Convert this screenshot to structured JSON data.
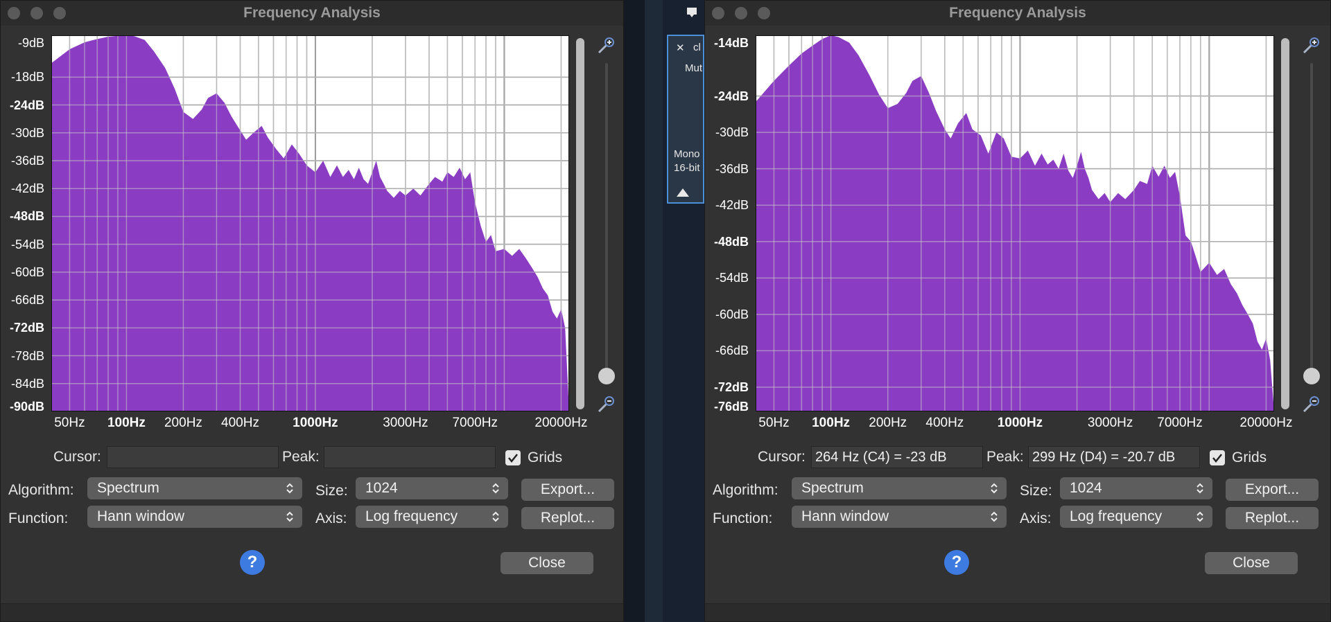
{
  "background_panel": {
    "close_glyph": "✕",
    "track_name": "cl",
    "mute_label": "Mut",
    "format_line1": "Mono",
    "format_line2": "16-bit"
  },
  "left_window": {
    "title": "Frequency Analysis",
    "cursor_label": "Cursor:",
    "cursor_value": "",
    "peak_label": "Peak:",
    "peak_value": "",
    "grids_label": "Grids",
    "grids_checked": true,
    "algorithm_label": "Algorithm:",
    "algorithm_value": "Spectrum",
    "size_label": "Size:",
    "size_value": "1024",
    "function_label": "Function:",
    "function_value": "Hann window",
    "axis_label": "Axis:",
    "axis_value": "Log frequency",
    "export_label": "Export...",
    "replot_label": "Replot...",
    "close_label": "Close",
    "help_glyph": "?",
    "db_labels": [
      "-9dB",
      "-18dB",
      "-24dB",
      "-30dB",
      "-36dB",
      "-42dB",
      "-48dB",
      "-54dB",
      "-60dB",
      "-66dB",
      "-72dB",
      "-78dB",
      "-84dB",
      "-90dB"
    ],
    "hz_labels": [
      "50Hz",
      "100Hz",
      "200Hz",
      "400Hz",
      "1000Hz",
      "3000Hz",
      "7000Hz",
      "20000Hz"
    ]
  },
  "right_window": {
    "title": "Frequency Analysis",
    "cursor_label": "Cursor:",
    "cursor_value": "264 Hz (C4) = -23 dB",
    "peak_label": "Peak:",
    "peak_value": "299 Hz (D4) = -20.7 dB",
    "grids_label": "Grids",
    "grids_checked": true,
    "algorithm_label": "Algorithm:",
    "algorithm_value": "Spectrum",
    "size_label": "Size:",
    "size_value": "1024",
    "function_label": "Function:",
    "function_value": "Hann window",
    "axis_label": "Axis:",
    "axis_value": "Log frequency",
    "export_label": "Export...",
    "replot_label": "Replot...",
    "close_label": "Close",
    "help_glyph": "?",
    "db_labels": [
      "-14dB",
      "-24dB",
      "-30dB",
      "-36dB",
      "-42dB",
      "-48dB",
      "-54dB",
      "-60dB",
      "-66dB",
      "-72dB",
      "-76dB"
    ],
    "hz_labels": [
      "50Hz",
      "100Hz",
      "200Hz",
      "400Hz",
      "1000Hz",
      "3000Hz",
      "7000Hz",
      "20000Hz"
    ]
  },
  "chart_data": [
    {
      "type": "area",
      "xscale": "log",
      "xlim": [
        40,
        22050
      ],
      "ylim": [
        -90,
        -9
      ],
      "ytick_labels": [
        "-9dB",
        "-18dB",
        "-24dB",
        "-30dB",
        "-36dB",
        "-42dB",
        "-48dB",
        "-54dB",
        "-60dB",
        "-66dB",
        "-72dB",
        "-78dB",
        "-84dB",
        "-90dB"
      ],
      "xtick_labels": [
        "50Hz",
        "100Hz",
        "200Hz",
        "400Hz",
        "1000Hz",
        "3000Hz",
        "7000Hz",
        "20000Hz"
      ],
      "grid": true,
      "color": "#8a3cc2",
      "x": [
        40,
        50,
        60,
        70,
        80,
        90,
        100,
        110,
        125,
        140,
        160,
        180,
        200,
        225,
        250,
        270,
        300,
        330,
        360,
        400,
        430,
        470,
        520,
        560,
        620,
        680,
        750,
        820,
        900,
        1000,
        1100,
        1200,
        1300,
        1400,
        1500,
        1600,
        1700,
        1800,
        1900,
        2000,
        2100,
        2200,
        2300,
        2400,
        2600,
        2800,
        3000,
        3300,
        3600,
        4000,
        4300,
        4700,
        5000,
        5400,
        5800,
        6200,
        6600,
        7000,
        7500,
        8000,
        8500,
        9000,
        10000,
        11000,
        12000,
        13000,
        14000,
        15000,
        16000,
        17000,
        18000,
        19000,
        20000,
        21000,
        22050
      ],
      "y": [
        -15,
        -12,
        -10.5,
        -9.8,
        -9.3,
        -9.1,
        -9,
        -9.2,
        -10,
        -12.5,
        -16,
        -20.5,
        -25.5,
        -27,
        -25,
        -22.5,
        -21.5,
        -23.5,
        -26.5,
        -29.5,
        -31.5,
        -30,
        -28.5,
        -31,
        -33.5,
        -35.5,
        -32.5,
        -34.5,
        -37,
        -38.5,
        -36,
        -39.5,
        -37,
        -39.5,
        -38,
        -40,
        -37.5,
        -40,
        -41,
        -38.5,
        -36,
        -39.5,
        -41,
        -42.5,
        -44,
        -42.5,
        -43.5,
        -42,
        -43.5,
        -41,
        -39.5,
        -40.5,
        -38.5,
        -39.5,
        -37.5,
        -40,
        -38.5,
        -45,
        -50,
        -53.5,
        -52,
        -55.5,
        -55,
        -56.5,
        -55,
        -57,
        -59,
        -61,
        -63.5,
        -65,
        -68.5,
        -70,
        -68,
        -72,
        -90
      ]
    },
    {
      "type": "area",
      "xscale": "log",
      "xlim": [
        40,
        22050
      ],
      "ylim": [
        -76,
        -14
      ],
      "ytick_labels": [
        "-14dB",
        "-24dB",
        "-30dB",
        "-36dB",
        "-42dB",
        "-48dB",
        "-54dB",
        "-60dB",
        "-66dB",
        "-72dB",
        "-76dB"
      ],
      "xtick_labels": [
        "50Hz",
        "100Hz",
        "200Hz",
        "400Hz",
        "1000Hz",
        "3000Hz",
        "7000Hz",
        "20000Hz"
      ],
      "grid": true,
      "color": "#8a3cc2",
      "x": [
        40,
        50,
        60,
        70,
        80,
        90,
        100,
        110,
        125,
        140,
        160,
        180,
        200,
        225,
        250,
        270,
        300,
        330,
        360,
        400,
        430,
        470,
        520,
        560,
        620,
        680,
        750,
        820,
        900,
        1000,
        1100,
        1200,
        1300,
        1400,
        1500,
        1600,
        1700,
        1800,
        1900,
        2000,
        2100,
        2200,
        2300,
        2400,
        2600,
        2800,
        3000,
        3300,
        3600,
        4000,
        4300,
        4700,
        5000,
        5400,
        5800,
        6200,
        6600,
        7000,
        7500,
        8000,
        8500,
        9000,
        10000,
        11000,
        12000,
        13000,
        14000,
        15000,
        16000,
        17000,
        18000,
        19000,
        20000,
        21000,
        22050
      ],
      "y": [
        -25,
        -21.5,
        -19,
        -17,
        -15.7,
        -14.6,
        -14,
        -14.3,
        -15.2,
        -17.3,
        -20.6,
        -23.8,
        -26,
        -25.3,
        -23.5,
        -21.5,
        -20.7,
        -23.5,
        -26.5,
        -29.5,
        -31,
        -28.5,
        -26.8,
        -29.5,
        -30.5,
        -33.5,
        -30,
        -31,
        -34,
        -34.3,
        -33,
        -35.5,
        -33.5,
        -35.3,
        -34.5,
        -36,
        -33.5,
        -36.3,
        -37.5,
        -35.5,
        -33.2,
        -36,
        -37.5,
        -39.5,
        -41,
        -40,
        -41.5,
        -40,
        -41,
        -39.5,
        -38,
        -38.5,
        -35.5,
        -37.3,
        -35.5,
        -37.5,
        -36.5,
        -40.5,
        -47,
        -48,
        -50.5,
        -53,
        -51.5,
        -53.5,
        -52.5,
        -55,
        -56.5,
        -58.5,
        -60,
        -61.5,
        -64.5,
        -65.8,
        -64,
        -67.5,
        -76
      ]
    }
  ]
}
